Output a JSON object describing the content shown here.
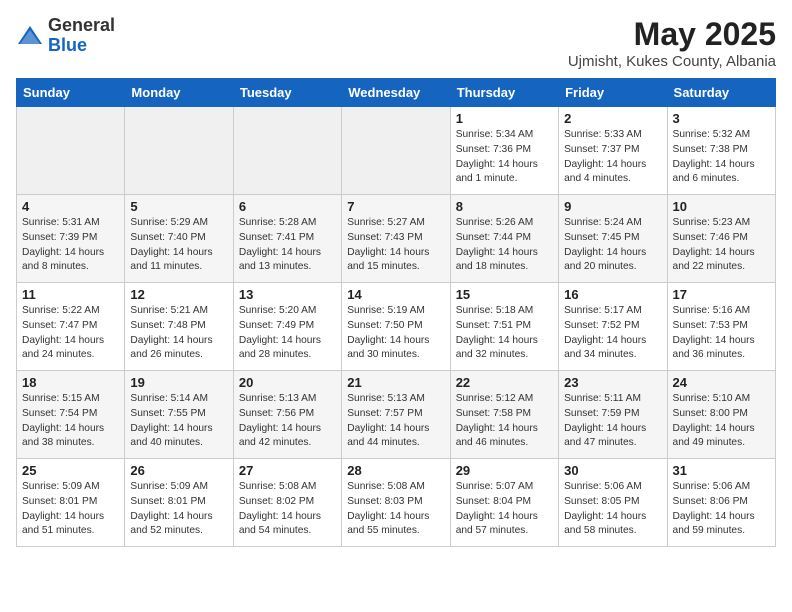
{
  "header": {
    "logo_general": "General",
    "logo_blue": "Blue",
    "month_year": "May 2025",
    "location": "Ujmisht, Kukes County, Albania"
  },
  "weekdays": [
    "Sunday",
    "Monday",
    "Tuesday",
    "Wednesday",
    "Thursday",
    "Friday",
    "Saturday"
  ],
  "weeks": [
    [
      {
        "num": "",
        "info": "",
        "empty": true
      },
      {
        "num": "",
        "info": "",
        "empty": true
      },
      {
        "num": "",
        "info": "",
        "empty": true
      },
      {
        "num": "",
        "info": "",
        "empty": true
      },
      {
        "num": "1",
        "info": "Sunrise: 5:34 AM\nSunset: 7:36 PM\nDaylight: 14 hours\nand 1 minute."
      },
      {
        "num": "2",
        "info": "Sunrise: 5:33 AM\nSunset: 7:37 PM\nDaylight: 14 hours\nand 4 minutes."
      },
      {
        "num": "3",
        "info": "Sunrise: 5:32 AM\nSunset: 7:38 PM\nDaylight: 14 hours\nand 6 minutes."
      }
    ],
    [
      {
        "num": "4",
        "info": "Sunrise: 5:31 AM\nSunset: 7:39 PM\nDaylight: 14 hours\nand 8 minutes."
      },
      {
        "num": "5",
        "info": "Sunrise: 5:29 AM\nSunset: 7:40 PM\nDaylight: 14 hours\nand 11 minutes."
      },
      {
        "num": "6",
        "info": "Sunrise: 5:28 AM\nSunset: 7:41 PM\nDaylight: 14 hours\nand 13 minutes."
      },
      {
        "num": "7",
        "info": "Sunrise: 5:27 AM\nSunset: 7:43 PM\nDaylight: 14 hours\nand 15 minutes."
      },
      {
        "num": "8",
        "info": "Sunrise: 5:26 AM\nSunset: 7:44 PM\nDaylight: 14 hours\nand 18 minutes."
      },
      {
        "num": "9",
        "info": "Sunrise: 5:24 AM\nSunset: 7:45 PM\nDaylight: 14 hours\nand 20 minutes."
      },
      {
        "num": "10",
        "info": "Sunrise: 5:23 AM\nSunset: 7:46 PM\nDaylight: 14 hours\nand 22 minutes."
      }
    ],
    [
      {
        "num": "11",
        "info": "Sunrise: 5:22 AM\nSunset: 7:47 PM\nDaylight: 14 hours\nand 24 minutes."
      },
      {
        "num": "12",
        "info": "Sunrise: 5:21 AM\nSunset: 7:48 PM\nDaylight: 14 hours\nand 26 minutes."
      },
      {
        "num": "13",
        "info": "Sunrise: 5:20 AM\nSunset: 7:49 PM\nDaylight: 14 hours\nand 28 minutes."
      },
      {
        "num": "14",
        "info": "Sunrise: 5:19 AM\nSunset: 7:50 PM\nDaylight: 14 hours\nand 30 minutes."
      },
      {
        "num": "15",
        "info": "Sunrise: 5:18 AM\nSunset: 7:51 PM\nDaylight: 14 hours\nand 32 minutes."
      },
      {
        "num": "16",
        "info": "Sunrise: 5:17 AM\nSunset: 7:52 PM\nDaylight: 14 hours\nand 34 minutes."
      },
      {
        "num": "17",
        "info": "Sunrise: 5:16 AM\nSunset: 7:53 PM\nDaylight: 14 hours\nand 36 minutes."
      }
    ],
    [
      {
        "num": "18",
        "info": "Sunrise: 5:15 AM\nSunset: 7:54 PM\nDaylight: 14 hours\nand 38 minutes."
      },
      {
        "num": "19",
        "info": "Sunrise: 5:14 AM\nSunset: 7:55 PM\nDaylight: 14 hours\nand 40 minutes."
      },
      {
        "num": "20",
        "info": "Sunrise: 5:13 AM\nSunset: 7:56 PM\nDaylight: 14 hours\nand 42 minutes."
      },
      {
        "num": "21",
        "info": "Sunrise: 5:13 AM\nSunset: 7:57 PM\nDaylight: 14 hours\nand 44 minutes."
      },
      {
        "num": "22",
        "info": "Sunrise: 5:12 AM\nSunset: 7:58 PM\nDaylight: 14 hours\nand 46 minutes."
      },
      {
        "num": "23",
        "info": "Sunrise: 5:11 AM\nSunset: 7:59 PM\nDaylight: 14 hours\nand 47 minutes."
      },
      {
        "num": "24",
        "info": "Sunrise: 5:10 AM\nSunset: 8:00 PM\nDaylight: 14 hours\nand 49 minutes."
      }
    ],
    [
      {
        "num": "25",
        "info": "Sunrise: 5:09 AM\nSunset: 8:01 PM\nDaylight: 14 hours\nand 51 minutes."
      },
      {
        "num": "26",
        "info": "Sunrise: 5:09 AM\nSunset: 8:01 PM\nDaylight: 14 hours\nand 52 minutes."
      },
      {
        "num": "27",
        "info": "Sunrise: 5:08 AM\nSunset: 8:02 PM\nDaylight: 14 hours\nand 54 minutes."
      },
      {
        "num": "28",
        "info": "Sunrise: 5:08 AM\nSunset: 8:03 PM\nDaylight: 14 hours\nand 55 minutes."
      },
      {
        "num": "29",
        "info": "Sunrise: 5:07 AM\nSunset: 8:04 PM\nDaylight: 14 hours\nand 57 minutes."
      },
      {
        "num": "30",
        "info": "Sunrise: 5:06 AM\nSunset: 8:05 PM\nDaylight: 14 hours\nand 58 minutes."
      },
      {
        "num": "31",
        "info": "Sunrise: 5:06 AM\nSunset: 8:06 PM\nDaylight: 14 hours\nand 59 minutes."
      }
    ]
  ]
}
